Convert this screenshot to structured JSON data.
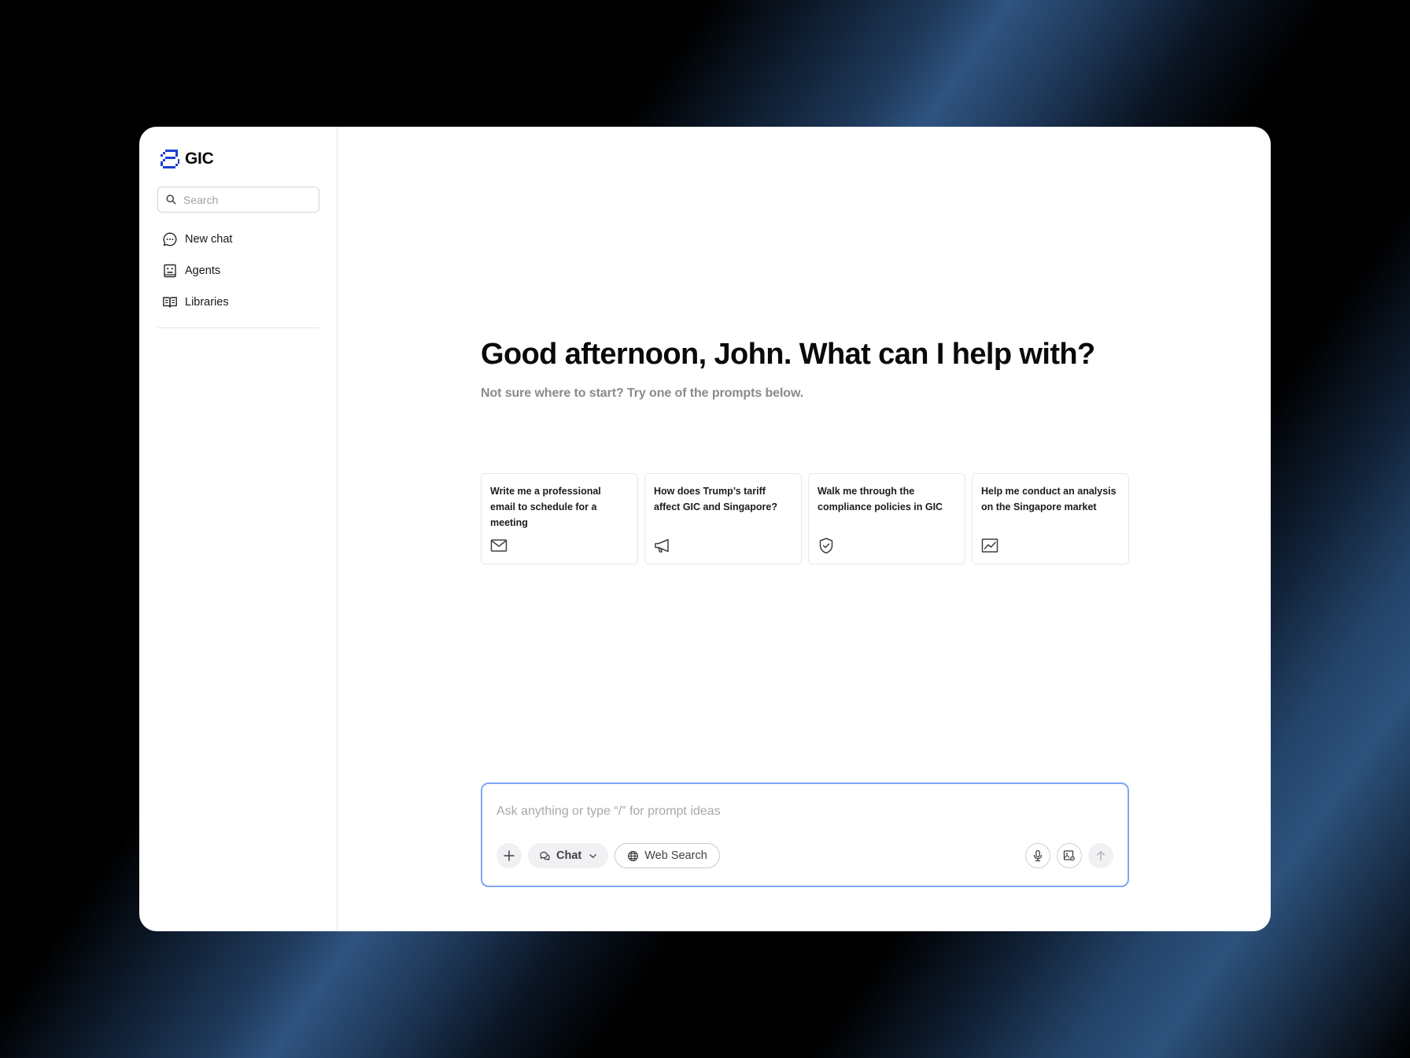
{
  "brand": {
    "name": "GIC",
    "logo_icon": "gic-logo-icon",
    "accent": "#1d3fd4"
  },
  "sidebar": {
    "search": {
      "placeholder": "Search",
      "value": ""
    },
    "items": [
      {
        "label": "New chat",
        "icon": "chat-bubble-icon"
      },
      {
        "label": "Agents",
        "icon": "agent-icon"
      },
      {
        "label": "Libraries",
        "icon": "book-icon"
      }
    ]
  },
  "main": {
    "greeting": "Good afternoon, John. What can I help with?",
    "subtitle": "Not sure where to start? Try one of the prompts below.",
    "prompts": [
      {
        "text": "Write me a professional email to schedule for a meeting",
        "icon": "mail-icon"
      },
      {
        "text": "How does Trump’s tariff affect GIC and Singapore?",
        "icon": "megaphone-icon"
      },
      {
        "text": "Walk me through the compliance policies in GIC",
        "icon": "shield-check-icon"
      },
      {
        "text": "Help me conduct an analysis on the Singapore market",
        "icon": "chart-line-icon"
      }
    ]
  },
  "composer": {
    "placeholder": "Ask anything or type “/” for prompt ideas",
    "value": "",
    "mode_label": "Chat",
    "web_search_label": "Web Search",
    "border_color": "#7ea6f5"
  }
}
